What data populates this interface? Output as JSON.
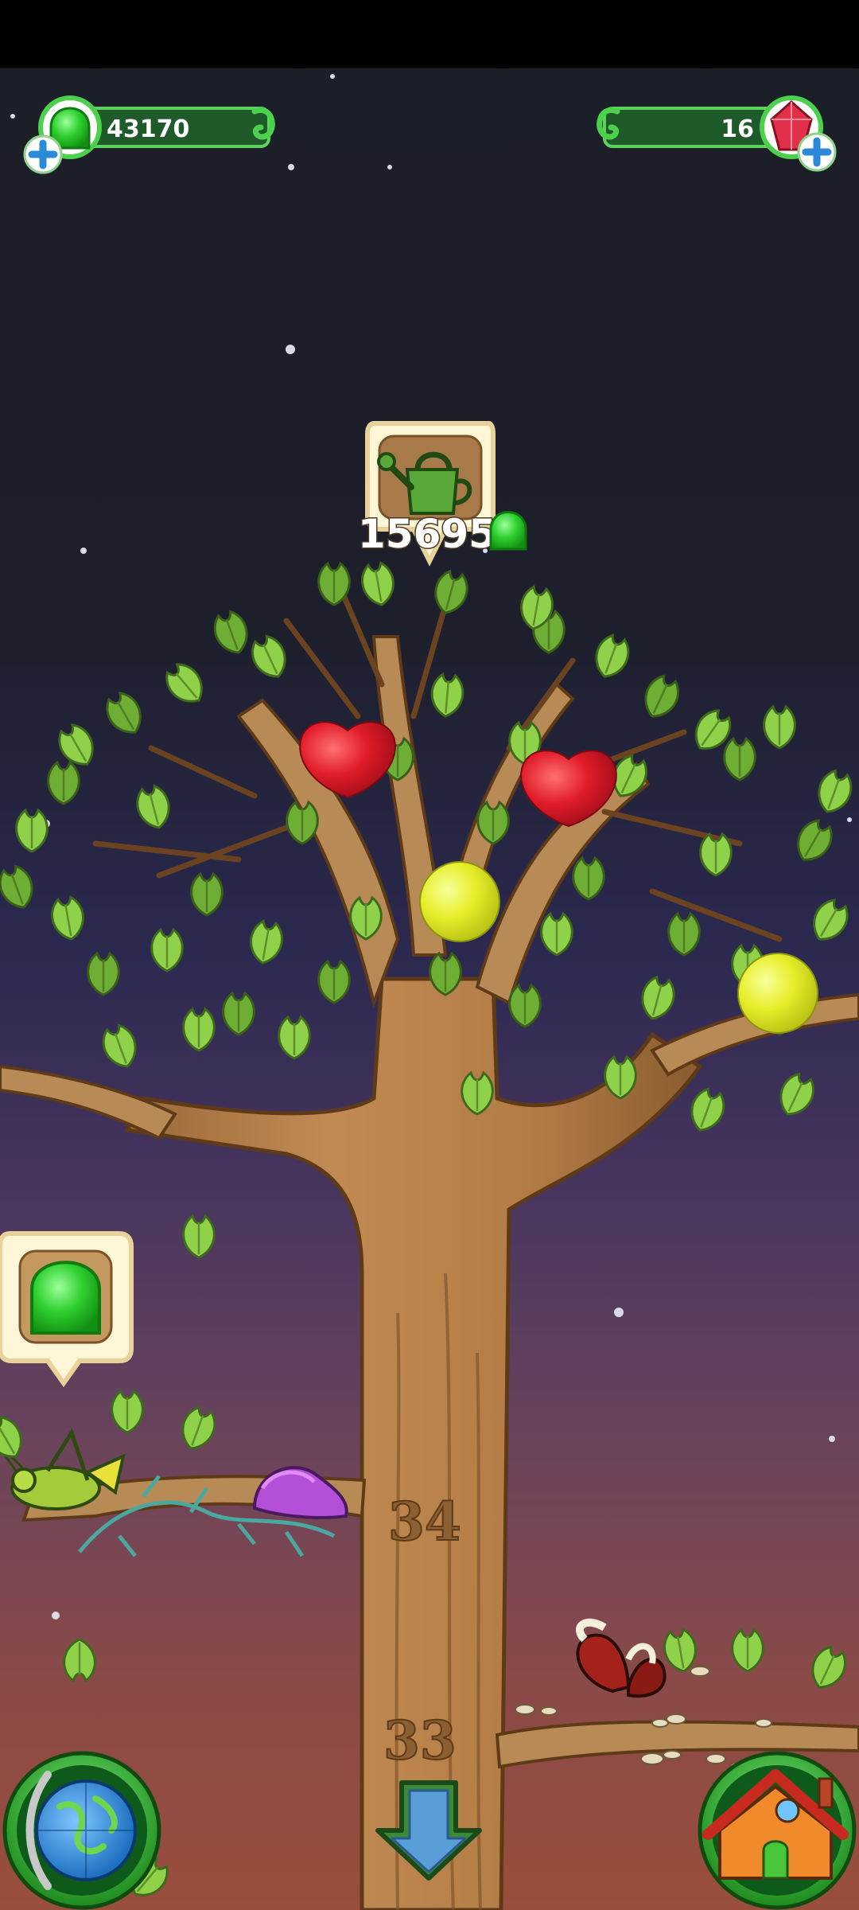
{
  "hud": {
    "jelly_count": "43170",
    "gem_count": "16"
  },
  "upgrade": {
    "cost": "15695",
    "icon": "watering-can-icon"
  },
  "tree": {
    "branch_upper": "34",
    "branch_lower": "33"
  },
  "bottom_bar": {
    "left_icon": "globe-icon",
    "center_icon": "down-arrow-icon",
    "right_icon": "house-icon"
  },
  "colors": {
    "jelly_green": "#2fd12f",
    "gem_red": "#e0304a",
    "hud_bar": "#1f5a2a",
    "plus_blue": "#2a8ad8"
  }
}
